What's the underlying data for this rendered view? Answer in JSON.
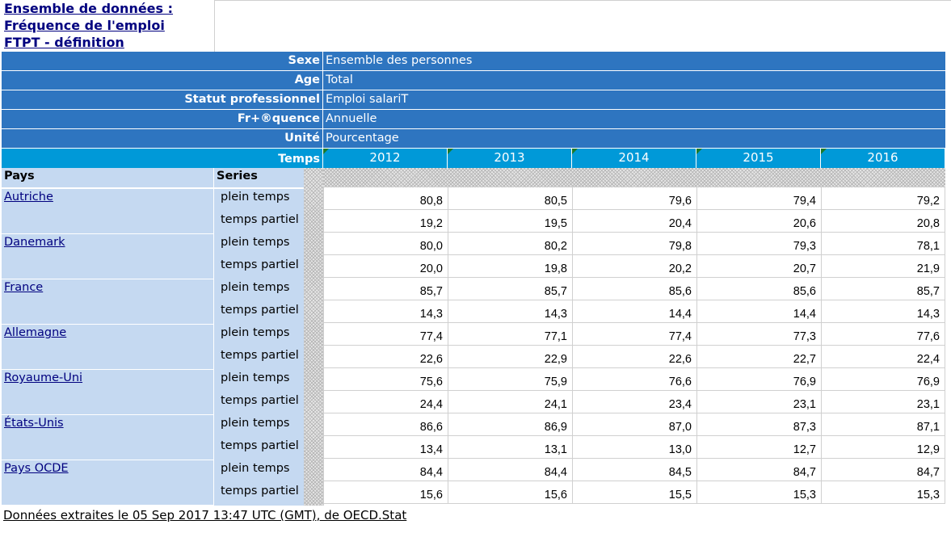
{
  "title": {
    "line1": "Ensemble de données :",
    "line2": "Fréquence de l'emploi",
    "line3": "FTPT - définition"
  },
  "header_rows": [
    {
      "label": "Sexe",
      "value": "Ensemble des personnes"
    },
    {
      "label": "Age",
      "value": "Total"
    },
    {
      "label": "Statut professionnel",
      "value": "Emploi salariT"
    },
    {
      "label": "Fr+®quence",
      "value": "Annuelle"
    },
    {
      "label": "Unité",
      "value": "Pourcentage"
    }
  ],
  "temps_label": "Temps",
  "years": [
    "2012",
    "2013",
    "2014",
    "2015",
    "2016"
  ],
  "col_pays": "Pays",
  "col_series": "Series",
  "rows": [
    {
      "pays": "Autriche",
      "series": [
        {
          "name": "plein temps",
          "values": [
            "80,8",
            "80,5",
            "79,6",
            "79,4",
            "79,2"
          ]
        },
        {
          "name": "temps partiel",
          "values": [
            "19,2",
            "19,5",
            "20,4",
            "20,6",
            "20,8"
          ]
        }
      ]
    },
    {
      "pays": "Danemark",
      "series": [
        {
          "name": "plein temps",
          "values": [
            "80,0",
            "80,2",
            "79,8",
            "79,3",
            "78,1"
          ]
        },
        {
          "name": "temps partiel",
          "values": [
            "20,0",
            "19,8",
            "20,2",
            "20,7",
            "21,9"
          ]
        }
      ]
    },
    {
      "pays": "France",
      "series": [
        {
          "name": "plein temps",
          "values": [
            "85,7",
            "85,7",
            "85,6",
            "85,6",
            "85,7"
          ]
        },
        {
          "name": "temps partiel",
          "values": [
            "14,3",
            "14,3",
            "14,4",
            "14,4",
            "14,3"
          ]
        }
      ]
    },
    {
      "pays": "Allemagne",
      "series": [
        {
          "name": "plein temps",
          "values": [
            "77,4",
            "77,1",
            "77,4",
            "77,3",
            "77,6"
          ]
        },
        {
          "name": "temps partiel",
          "values": [
            "22,6",
            "22,9",
            "22,6",
            "22,7",
            "22,4"
          ]
        }
      ]
    },
    {
      "pays": "Royaume-Uni",
      "series": [
        {
          "name": "plein temps",
          "values": [
            "75,6",
            "75,9",
            "76,6",
            "76,9",
            "76,9"
          ]
        },
        {
          "name": "temps partiel",
          "values": [
            "24,4",
            "24,1",
            "23,4",
            "23,1",
            "23,1"
          ]
        }
      ]
    },
    {
      "pays": "États-Unis",
      "series": [
        {
          "name": "plein temps",
          "values": [
            "86,6",
            "86,9",
            "87,0",
            "87,3",
            "87,1"
          ]
        },
        {
          "name": "temps partiel",
          "values": [
            "13,4",
            "13,1",
            "13,0",
            "12,7",
            "12,9"
          ]
        }
      ]
    },
    {
      "pays": "Pays OCDE",
      "series": [
        {
          "name": "plein temps",
          "values": [
            "84,4",
            "84,4",
            "84,5",
            "84,7",
            "84,7"
          ]
        },
        {
          "name": "temps partiel",
          "values": [
            "15,6",
            "15,6",
            "15,5",
            "15,3",
            "15,3"
          ]
        }
      ]
    }
  ],
  "footer": "Données extraites le 05 Sep 2017 13:47 UTC (GMT), de OECD.Stat",
  "colors": {
    "header_bg": "#2e75c0",
    "temps_bg": "#0099d8",
    "label_bg": "#c5d9f1",
    "link": "#00007f"
  }
}
